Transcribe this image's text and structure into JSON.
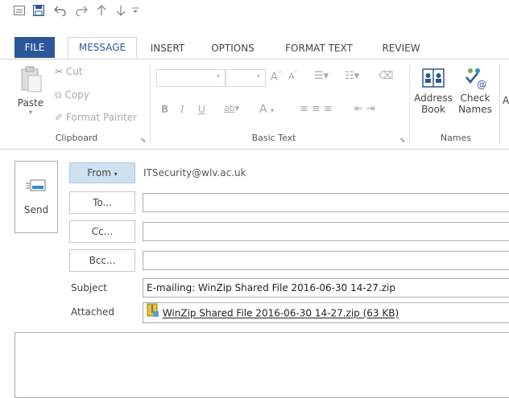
{
  "quick_access": {
    "icons": [
      "window-icon",
      "save-icon",
      "undo-icon",
      "redo-icon",
      "up-arrow-icon",
      "down-arrow-icon",
      "customize-icon"
    ]
  },
  "tabs": [
    {
      "label": "FILE"
    },
    {
      "label": "MESSAGE"
    },
    {
      "label": "INSERT"
    },
    {
      "label": "OPTIONS"
    },
    {
      "label": "FORMAT TEXT"
    },
    {
      "label": "REVIEW"
    }
  ],
  "ribbon": {
    "clipboard": {
      "paste": "Paste",
      "cut": "Cut",
      "copy": "Copy",
      "format_painter": "Format Painter",
      "group_label": "Clipboard"
    },
    "basic_text": {
      "bold": "B",
      "italic": "I",
      "underline": "U",
      "font_color": "A",
      "group_label": "Basic Text"
    },
    "names": {
      "address_book_line1": "Address",
      "address_book_line2": "Book",
      "check_names_line1": "Check",
      "check_names_line2": "Names",
      "group_label": "Names",
      "next_partial": "A"
    }
  },
  "compose": {
    "send": "Send",
    "from_label": "From",
    "from_value": "ITSecurity@wlv.ac.uk",
    "to_label": "To...",
    "cc_label": "Cc...",
    "bcc_label": "Bcc...",
    "to_value": "",
    "cc_value": "",
    "bcc_value": "",
    "subject_label": "Subject",
    "subject_value": "E-mailing: WinZip Shared File 2016-06-30 14-27.zip",
    "attached_label": "Attached",
    "attachment_name": "WinZip Shared File 2016-06-30 14-27.zip (63 KB)",
    "body": ""
  },
  "colors": {
    "accent": "#2B579A",
    "from_button_bg": "#CFE0F1",
    "border": "#ABABAB"
  }
}
